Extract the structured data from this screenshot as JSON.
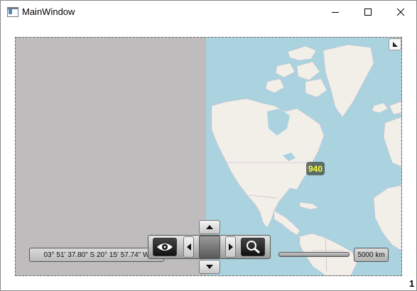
{
  "window": {
    "title": "MainWindow",
    "controls": {
      "minimize": "minimize-icon",
      "maximize": "maximize-icon",
      "close": "close-icon"
    }
  },
  "map": {
    "cluster_count": "940",
    "coordinates": "03° 51' 37.80\" S 20° 15' 57.74\" W",
    "scale_label": "5000 km",
    "corner_number": "1",
    "colors": {
      "water": "#aad3df",
      "land": "#f2efe9",
      "grid_background": "#bebcbd",
      "cluster_text": "#ffff3a"
    }
  },
  "navigation": {
    "eye": "eye-icon",
    "zoom": "magnifier-icon",
    "pan_up": "arrow-up-icon",
    "pan_down": "arrow-down-icon",
    "pan_left": "arrow-left-icon",
    "pan_right": "arrow-right-icon"
  }
}
